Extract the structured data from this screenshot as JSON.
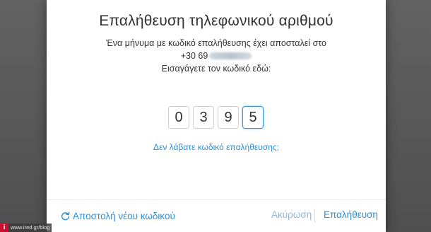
{
  "dialog": {
    "title": "Επαλήθευση τηλεφωνικού αριθμού",
    "message_line1": "Ένα μήνυμα με κωδικό επαλήθευσης έχει αποσταλεί στο",
    "phone_prefix": "+30 69",
    "message_line3": "Εισαγάγετε τον κωδικό εδώ:",
    "code_digits": [
      "0",
      "3",
      "9",
      "5"
    ],
    "resend_prompt": "Δεν λάβατε κωδικό επαλήθευσης;"
  },
  "footer": {
    "resend_label": "Αποστολή νέου κωδικού",
    "cancel_label": "Ακύρωση",
    "verify_label": "Επαλήθευση"
  },
  "watermark": {
    "logo": "i",
    "text": "www.ired.gr/blog"
  },
  "colors": {
    "accent": "#2f8fd4",
    "accent_disabled": "#8fb9dc",
    "active_border": "#3a95d6"
  }
}
